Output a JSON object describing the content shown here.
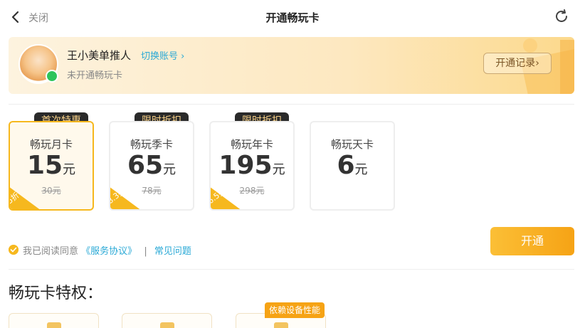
{
  "header": {
    "close_label": "关闭",
    "title": "开通畅玩卡"
  },
  "account": {
    "username": "王小美单推人",
    "switch_label": "切换账号",
    "status": "未开通畅玩卡",
    "records_label": "开通记录"
  },
  "plans": [
    {
      "name": "畅玩月卡",
      "price": "15",
      "unit": "元",
      "original": "30元",
      "tag": "首次特惠",
      "discount": "5折",
      "selected": true
    },
    {
      "name": "畅玩季卡",
      "price": "65",
      "unit": "元",
      "original": "78元",
      "tag": "限时折扣",
      "discount": "8.3折",
      "selected": false
    },
    {
      "name": "畅玩年卡",
      "price": "195",
      "unit": "元",
      "original": "298元",
      "tag": "限时折扣",
      "discount": "6.5折",
      "selected": false
    },
    {
      "name": "畅玩天卡",
      "price": "6",
      "unit": "元",
      "original": "",
      "tag": "",
      "discount": "",
      "selected": false
    }
  ],
  "agreement": {
    "prefix": "我已阅读同意",
    "service_link": "《服务协议》",
    "separator": "|",
    "faq_link": "常见问题"
  },
  "actions": {
    "open_label": "开通"
  },
  "privileges": {
    "title": "畅玩卡特权：",
    "tag": "依赖设备性能"
  },
  "colors": {
    "accent": "#f6b81e",
    "link": "#2aa9d6",
    "tag_bg": "#2a2a2a",
    "tag_text": "#f8d188"
  },
  "icons": {
    "back": "chevron-left-icon",
    "refresh": "refresh-icon",
    "wechat": "wechat-icon"
  }
}
